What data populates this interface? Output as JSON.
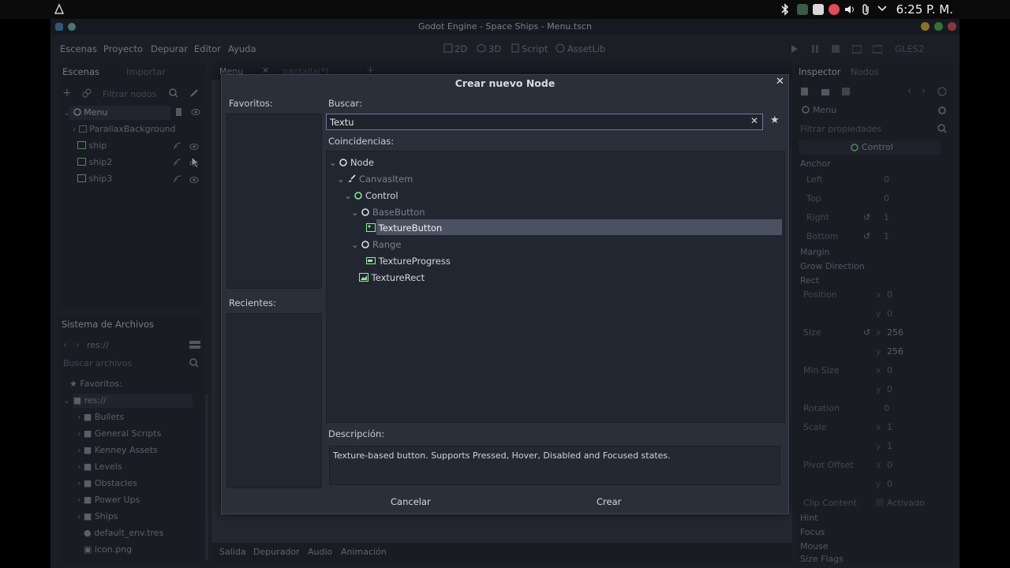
{
  "system": {
    "clock": "6:25 P. M."
  },
  "window": {
    "title": "Godot Engine - Space Ships - Menu.tscn"
  },
  "menu": [
    "Escenas",
    "Proyecto",
    "Depurar",
    "Editor",
    "Ayuda"
  ],
  "workspaces": {
    "w2d": "2D",
    "w3d": "3D",
    "script": "Script",
    "assetlib": "AssetLib"
  },
  "renderer": "GLES2",
  "scene_dock": {
    "tab_scene": "Escenas",
    "tab_import": "Importar",
    "filter_placeholder": "Filtrar nodos",
    "nodes": [
      "Menu",
      "ParallaxBackground",
      "ship",
      "ship2",
      "ship3"
    ]
  },
  "editor_tabs": [
    "Menu",
    "pantalla(*)"
  ],
  "filesystem": {
    "title": "Sistema de Archivos",
    "path": "res://",
    "search_placeholder": "Buscar archivos",
    "favorites": "Favoritos:",
    "root": "res://",
    "items": [
      "Bullets",
      "General Scripts",
      "Kenney Assets",
      "Levels",
      "Obstacles",
      "Power Ups",
      "Ships",
      "default_env.tres",
      "icon.png"
    ]
  },
  "bottom_tabs": [
    "Salida",
    "Depurador",
    "Audio",
    "Animación"
  ],
  "inspector": {
    "tab_inspector": "Inspector",
    "tab_nodes": "Nodos",
    "object": "Menu",
    "filter_placeholder": "Filtrar propiedades",
    "class": "Control",
    "sections": {
      "anchor": "Anchor",
      "margin": "Margin",
      "grow": "Grow Direction",
      "rect": "Rect",
      "hint": "Hint",
      "focus": "Focus",
      "mouse": "Mouse",
      "size_flags": "Size Flags"
    },
    "anchor": [
      {
        "label": "Left",
        "value": "0"
      },
      {
        "label": "Top",
        "value": "0"
      },
      {
        "label": "Right",
        "value": "1"
      },
      {
        "label": "Bottom",
        "value": "1"
      }
    ],
    "rect": {
      "position_label": "Position",
      "position_x": "0",
      "position_y": "0",
      "size_label": "Size",
      "size_x": "256",
      "size_y": "256",
      "min_size_label": "Min Size",
      "min_x": "0",
      "min_y": "0",
      "rotation_label": "Rotation",
      "rotation": "0",
      "scale_label": "Scale",
      "scale_x": "1",
      "scale_y": "1",
      "pivot_label": "Pivot Offset",
      "pivot_x": "0",
      "pivot_y": "0",
      "clip_label": "Clip Content",
      "clip_value": "Activado"
    }
  },
  "dialog": {
    "title": "Crear nuevo Node",
    "favorites_label": "Favoritos:",
    "recents_label": "Recientes:",
    "search_label": "Buscar:",
    "search_value": "Textu",
    "matches_label": "Coincidencias:",
    "tree": [
      {
        "name": "Node",
        "dim": false
      },
      {
        "name": "CanvasItem",
        "dim": true
      },
      {
        "name": "Control",
        "dim": false
      },
      {
        "name": "BaseButton",
        "dim": true
      },
      {
        "name": "TextureButton",
        "dim": false,
        "selected": true
      },
      {
        "name": "Range",
        "dim": true
      },
      {
        "name": "TextureProgress",
        "dim": false
      },
      {
        "name": "TextureRect",
        "dim": false
      }
    ],
    "description_label": "Descripción:",
    "description": "Texture-based button. Supports Pressed, Hover, Disabled and Focused states.",
    "cancel": "Cancelar",
    "create": "Crear"
  },
  "colors": {
    "accent": "#6c7aa6",
    "node_green": "#8eef97",
    "selection": "#4a5160"
  }
}
